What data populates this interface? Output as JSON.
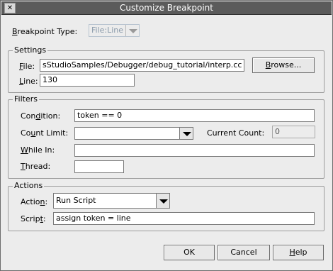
{
  "window": {
    "title": "Customize Breakpoint",
    "close_glyph": "✕"
  },
  "breakpoint_type": {
    "label": "Breakpoint Type:",
    "value": "File:Line",
    "accelerator": "B"
  },
  "settings": {
    "title": "Settings",
    "file_label": "File:",
    "file_value": "sStudioSamples/Debugger/debug_tutorial/interp.cc",
    "browse_label": "Browse...",
    "line_label": "Line:",
    "line_value": "130"
  },
  "filters": {
    "title": "Filters",
    "condition_label": "Condition:",
    "condition_value": "token == 0",
    "count_limit_label": "Count Limit:",
    "count_limit_value": "",
    "current_count_label": "Current Count:",
    "current_count_value": "0",
    "while_in_label": "While In:",
    "while_in_value": "",
    "thread_label": "Thread:",
    "thread_value": ""
  },
  "actions": {
    "title": "Actions",
    "action_label": "Action:",
    "action_value": "Run Script",
    "script_label": "Script:",
    "script_value": "assign token = line"
  },
  "buttons": {
    "ok": "OK",
    "cancel": "Cancel",
    "help": "Help"
  }
}
